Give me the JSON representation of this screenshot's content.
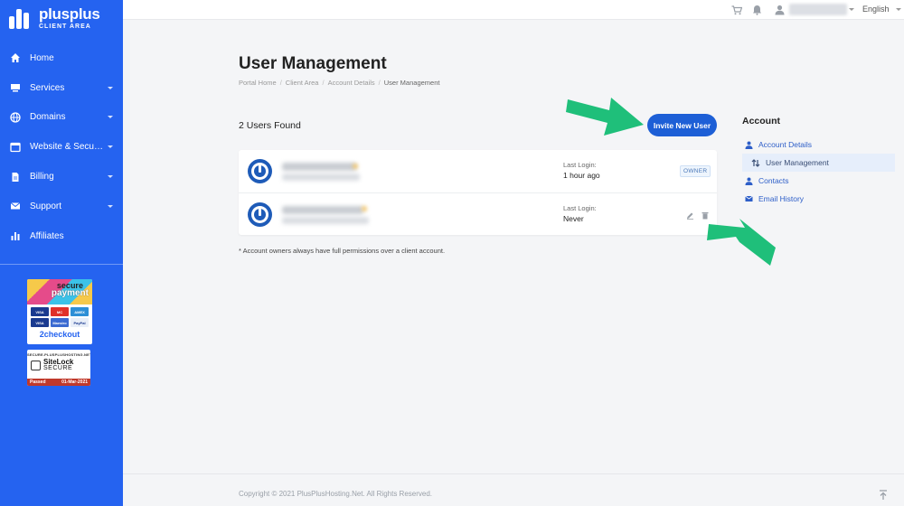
{
  "brand": {
    "name": "plusplus",
    "sub": "CLIENT AREA"
  },
  "sidebar": {
    "items": [
      {
        "label": "Home",
        "icon": "home-icon",
        "dropdown": false
      },
      {
        "label": "Services",
        "icon": "server-icon",
        "dropdown": true
      },
      {
        "label": "Domains",
        "icon": "globe-icon",
        "dropdown": true
      },
      {
        "label": "Website & Security",
        "icon": "browser-icon",
        "dropdown": true
      },
      {
        "label": "Billing",
        "icon": "invoice-icon",
        "dropdown": true
      },
      {
        "label": "Support",
        "icon": "envelope-icon",
        "dropdown": true
      },
      {
        "label": "Affiliates",
        "icon": "bar-chart-icon",
        "dropdown": false
      }
    ]
  },
  "badges": {
    "payment": {
      "line1": "secure",
      "line2": "payment",
      "footer": "2checkout",
      "cards": [
        "VISA",
        "MC",
        "AMEX",
        "VISA",
        "Maestro",
        "PayPal"
      ]
    },
    "sitelock": {
      "url": "SECURE.PLUSPLUSHOSTING.NET",
      "line1": "SiteLock",
      "line2": "SECURE",
      "status": "Passed",
      "date": "01-Mar-2021"
    }
  },
  "topbar": {
    "language": "English"
  },
  "main": {
    "title": "User Management",
    "breadcrumb": [
      "Portal Home",
      "Client Area",
      "Account Details",
      "User Management"
    ],
    "users_found": "2 Users Found",
    "invite_button": "Invite New User",
    "users": [
      {
        "last_login_label": "Last Login:",
        "last_login": "1 hour ago",
        "badge": "OWNER"
      },
      {
        "last_login_label": "Last Login:",
        "last_login": "Never",
        "badge": ""
      }
    ],
    "footnote": "* Account owners always have full permissions over a client account."
  },
  "side_panel": {
    "title": "Account",
    "items": [
      {
        "label": "Account Details",
        "icon": "user-icon"
      },
      {
        "label": "User Management",
        "icon": "arrows-swap-icon"
      },
      {
        "label": "Contacts",
        "icon": "user-icon"
      },
      {
        "label": "Email History",
        "icon": "email-icon"
      }
    ]
  },
  "footer": {
    "copyright": "Copyright © 2021 PlusPlusHosting.Net. All Rights Reserved."
  },
  "colors": {
    "sidebar": "#2563f0",
    "accent": "#1d5fd6",
    "annotation_arrow": "#1fbf7a"
  }
}
